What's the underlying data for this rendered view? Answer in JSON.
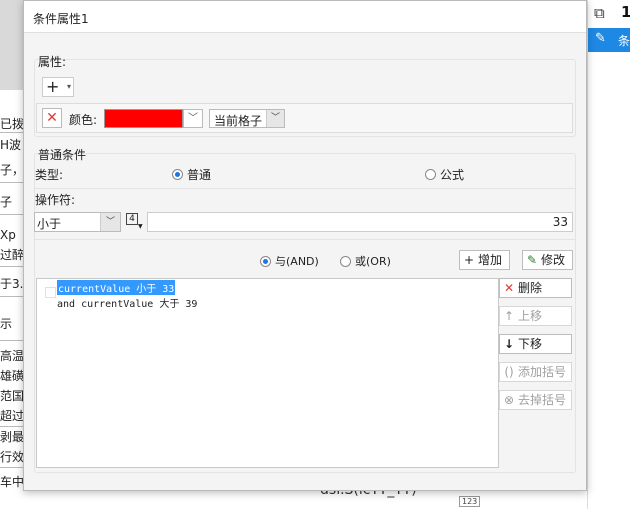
{
  "background": {
    "left_fragments": [
      "已拨",
      "H波",
      "子，",
      "子",
      "Xp",
      "过醉",
      "于3.",
      "示",
      "高温",
      "雄磺",
      "范国",
      "超过",
      "剥最",
      "行效",
      "车中"
    ],
    "right": {
      "doc_icon": "copy-icon",
      "number": "1",
      "edit_cut_text": "条"
    },
    "bottom_text": "dsf.S(icTT_TT)",
    "bottom_badge": "123"
  },
  "dialog": {
    "title": "条件属性1",
    "property_section": {
      "label": "属性:",
      "add_button": "+",
      "color_label": "颜色:",
      "color_value": "#ff0000",
      "scope_value": "当前格子"
    },
    "normal_condition": {
      "label": "普通条件",
      "type_label": "类型:",
      "type_options": [
        {
          "label": "普通",
          "selected": true
        },
        {
          "label": "公式",
          "selected": false
        }
      ],
      "operator_label": "操作符:",
      "operator_value": "小于",
      "value": "33"
    },
    "logic": {
      "options": [
        {
          "label": "与(AND)",
          "selected": true
        },
        {
          "label": "或(OR)",
          "selected": false
        }
      ],
      "add_button": "增加",
      "modify_button": "修改"
    },
    "conditions": [
      {
        "text": "currentValue 小于 33",
        "selected": true
      },
      {
        "text": "and currentValue 大于 39",
        "selected": false
      }
    ],
    "side_buttons": {
      "delete": "删除",
      "move_up": "上移",
      "move_down": "下移",
      "add_bracket": "添加括号",
      "remove_bracket": "去掉括号"
    }
  }
}
